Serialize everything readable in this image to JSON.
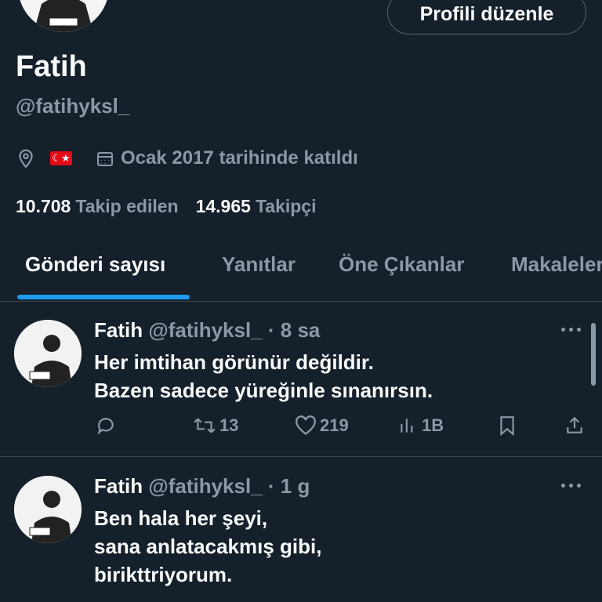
{
  "profile": {
    "name": "Fatih",
    "handle": "@fatihyksl_",
    "edit_button": "Profili düzenle",
    "flag": "☾★",
    "joined": "Ocak 2017 tarihinde katıldı",
    "following_count": "10.708",
    "following_label": "Takip edilen",
    "followers_count": "14.965",
    "followers_label": "Takipçi"
  },
  "tabs": [
    {
      "label": "Gönderi sayısı",
      "active": true
    },
    {
      "label": "Yanıtlar"
    },
    {
      "label": "Öne Çıkanlar"
    },
    {
      "label": "Makaleler"
    }
  ],
  "tweets": [
    {
      "name": "Fatih",
      "handle": "@fatihyksl_",
      "time": "· 8 sa",
      "lines": [
        "Her imtihan görünür değildir.",
        "Bazen sadece yüreğinle sınanırsın."
      ],
      "retweets": "13",
      "likes": "219",
      "views": "1B"
    },
    {
      "name": "Fatih",
      "handle": "@fatihyksl_",
      "time": "· 1 g",
      "lines": [
        "Ben hala her şeyi,",
        "sana anlatacakmış gibi,",
        "birikttriyorum."
      ]
    }
  ],
  "colors": {
    "background": "#15202b",
    "accent": "#1d9bf0",
    "muted": "#8b98a5"
  }
}
